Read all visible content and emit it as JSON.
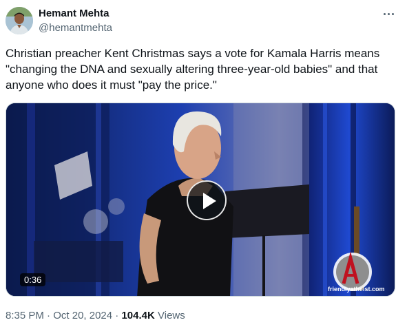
{
  "author": {
    "display_name": "Hemant Mehta",
    "handle": "@hemantmehta"
  },
  "tweet": {
    "text": "Christian preacher Kent Christmas says a vote for Kamala Harris means \"changing the DNA and sexually altering three-year-old babies\" and that anyone who does it must \"pay the price.\"",
    "video_duration": "0:36",
    "watermark": "friendlyatheist.com"
  },
  "meta": {
    "time": "8:35 PM",
    "separator": " · ",
    "date": "Oct 20, 2024",
    "views_count": "104.4K",
    "views_label": "Views"
  },
  "icons": {
    "more": "more-horizontal-icon",
    "play": "play-icon",
    "watermark_logo": "friendly-atheist-logo"
  },
  "colors": {
    "text_primary": "#0f1419",
    "text_secondary": "#536471",
    "stage_blue": "#1b3fa8"
  }
}
